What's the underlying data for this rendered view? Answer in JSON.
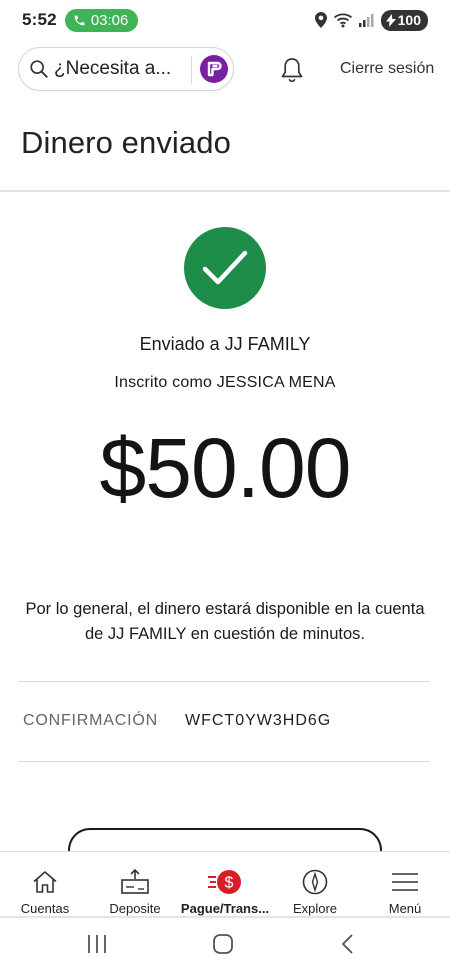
{
  "status_bar": {
    "time": "5:52",
    "call_timer": "03:06",
    "battery": "100"
  },
  "header": {
    "search_placeholder": "¿Necesita a...",
    "logout_label": "Cierre sesión"
  },
  "page": {
    "title": "Dinero enviado"
  },
  "confirmation": {
    "sent_to": "Enviado a JJ FAMILY",
    "enrolled_as": "Inscrito como JESSICA MENA",
    "amount": "$50.00",
    "availability_note": "Por lo general, el dinero estará disponible en la cuenta de JJ FAMILY en cuestión de minutos.",
    "confirmation_label": "CONFIRMACIÓN",
    "confirmation_number": "WFCT0YW3HD6G"
  },
  "bottom_nav": {
    "items": [
      {
        "label": "Cuentas",
        "icon": "home-icon"
      },
      {
        "label": "Deposite",
        "icon": "deposit-icon"
      },
      {
        "label": "Pague/Trans...",
        "icon": "pay-transfer-icon"
      },
      {
        "label": "Explore",
        "icon": "compass-icon"
      },
      {
        "label": "Menú",
        "icon": "hamburger-menu-icon"
      }
    ]
  },
  "colors": {
    "success_green": "#1f8d4a",
    "call_green": "#3fb356",
    "pay_red": "#d71e28",
    "logo_purple": "#7b1fa2"
  }
}
